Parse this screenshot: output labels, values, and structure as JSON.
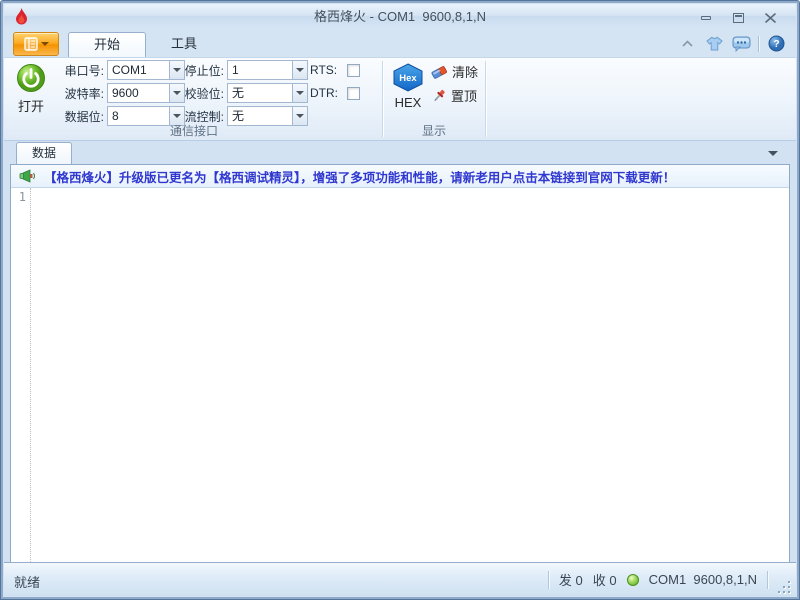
{
  "window": {
    "title": "格西烽火 - COM1  9600,8,1,N",
    "icons": {
      "app": "flame-icon",
      "controls": [
        "minimize-icon",
        "maximize-icon",
        "close-icon"
      ]
    }
  },
  "ribbon": {
    "app_button_icon": "notebook-menu-icon",
    "tabs": [
      {
        "label": "开始",
        "active": true
      },
      {
        "label": "工具",
        "active": false
      }
    ],
    "quick_access_icons": [
      "collapse-ribbon-icon",
      "skin-icon",
      "feedback-icon",
      "help-icon"
    ],
    "comm": {
      "label": "通信接口",
      "open_label": "打开",
      "open_icon": "power-icon",
      "fields": [
        {
          "label": "串口号:",
          "value": "COM1"
        },
        {
          "label": "波特率:",
          "value": "9600"
        },
        {
          "label": "数据位:",
          "value": "8"
        },
        {
          "label": "停止位:",
          "value": "1"
        },
        {
          "label": "校验位:",
          "value": "无"
        },
        {
          "label": "流控制:",
          "value": "无"
        }
      ],
      "rts_label": "RTS:",
      "rts_checked": false,
      "dtr_label": "DTR:",
      "dtr_checked": false
    },
    "display": {
      "label": "显示",
      "hex_icon_text": "Hex",
      "hex_label": "HEX",
      "clear_label": "清除",
      "clear_icon": "eraser-icon",
      "top_label": "置顶",
      "top_icon": "pushpin-icon"
    }
  },
  "document": {
    "tab_label": "数据",
    "notice": "【格西烽火】升级版已更名为【格西调试精灵】，增强了多项功能和性能，请新老用户点击本链接到官网下载更新！",
    "notice_icon": "megaphone-icon",
    "line_number": "1"
  },
  "statusbar": {
    "ready": "就绪",
    "tx": "发 0",
    "rx": "收 0",
    "led_color": "#6fbc2f",
    "connection": "COM1  9600,8,1,N"
  },
  "colors": {
    "accent_orange": "#f9a01b",
    "frame_blue": "#8fa9c9",
    "hex_blue": "#1b6cc8",
    "notice_blue": "#3038cf",
    "power_green": "#6dbb2c"
  }
}
